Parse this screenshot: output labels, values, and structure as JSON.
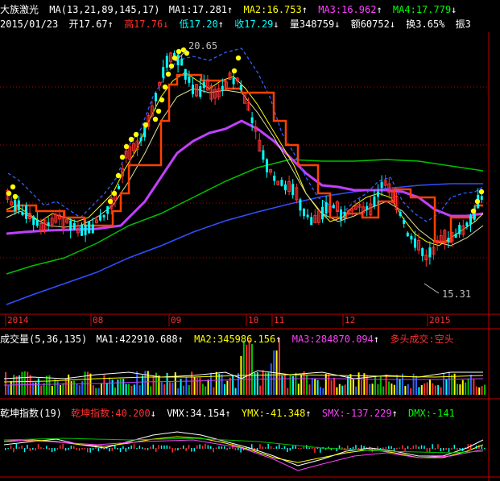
{
  "header": {
    "stock_name": "大族激光",
    "ma_params": "MA(13,21,89,145,17)",
    "ma1": "MA1:17.281",
    "ma1_arrow": "↑",
    "ma2": "MA2:16.753",
    "ma2_arrow": "↑",
    "ma3": "MA3:16.962",
    "ma3_arrow": "↑",
    "ma4": "MA4:17.779",
    "ma4_arrow": "↓"
  },
  "quote": {
    "date": "2015/01/23",
    "open": "开17.67",
    "open_arrow": "↑",
    "high": "高17.76",
    "high_arrow": "↓",
    "low": "低17.20",
    "low_arrow": "↑",
    "close": "收17.29",
    "close_arrow": "↓",
    "volume": "量348759",
    "volume_arrow": "↓",
    "amount": "额60752",
    "amount_arrow": "↓",
    "turnover": "换3.65%",
    "amplitude": "振3"
  },
  "price_annotations": {
    "high": "20.65",
    "low": "15.31"
  },
  "time_axis": [
    "2014",
    "08",
    "09",
    "10",
    "11",
    "12",
    "2015"
  ],
  "volume_panel": {
    "title": "成交量(5,36,135)",
    "ma1": "MA1:422910.688",
    "ma1_arrow": "↑",
    "ma2": "MA2:345986.156",
    "ma2_arrow": "↑",
    "ma3": "MA3:284870.094",
    "ma3_arrow": "↑",
    "signal": "多头成交:空头"
  },
  "indicator_panel": {
    "title": "乾坤指数(19)",
    "main": "乾坤指数:40.200",
    "main_arrow": "↓",
    "vmx": "VMX:34.154",
    "vmx_arrow": "↑",
    "ymx": "YMX:-41.348",
    "ymx_arrow": "↑",
    "smx": "SMX:-137.229",
    "smx_arrow": "↑",
    "dmx": "DMX:-141"
  },
  "colors": {
    "background": "#000000",
    "up_candle": "#ff3030",
    "down_candle": "#00ffff",
    "ma1": "#ffff00",
    "ma2": "#ff4000",
    "ma3": "#c040ff",
    "ma4": "#00c000",
    "ma5": "#3050ff",
    "axis": "#c00000"
  }
}
